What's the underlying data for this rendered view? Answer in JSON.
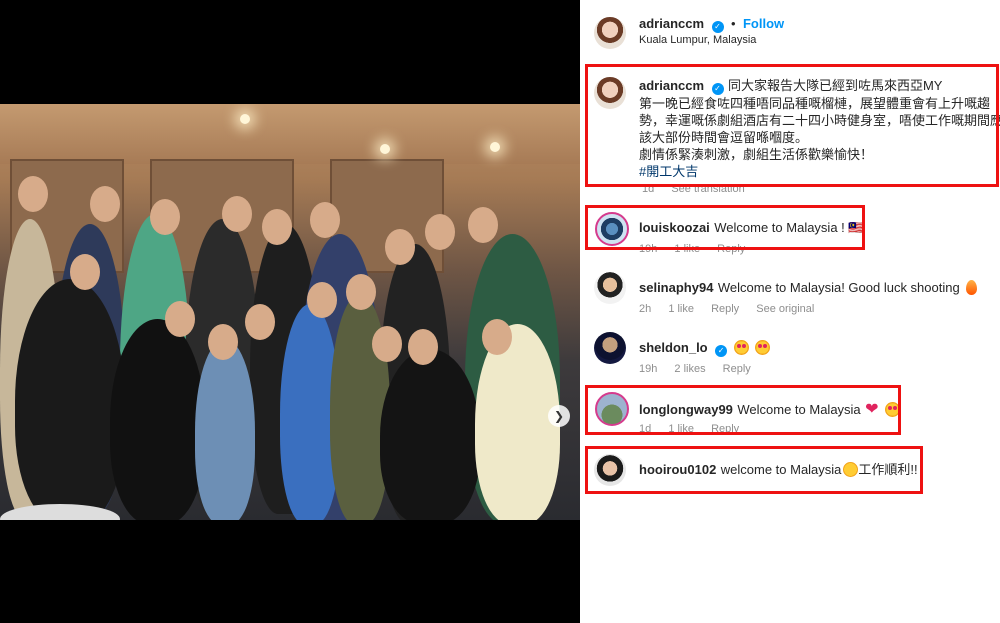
{
  "post": {
    "username": "adrianccm",
    "follow_label": "Follow",
    "separator": "•",
    "location": "Kuala Lumpur, Malaysia",
    "caption_line1": "同大家報告大隊已經到咗馬來西亞MY",
    "caption_line2": "第一晚已經食咗四種唔同品種嘅榴槤，展望體重會有上升嘅趨",
    "caption_line3": "勢，幸運嘅係劇組酒店有二十四小時健身室，唔使工作嘅期間應",
    "caption_line4": "該大部份時間會逗留喺嗰度。",
    "caption_line5": "劇情係緊湊刺激，劇組生活係歡樂愉快！",
    "hashtag": "#開工大吉",
    "time": "1d",
    "see_translation": "See translation"
  },
  "comments": [
    {
      "username": "louiskoozai",
      "text": "Welcome to Malaysia ! 🇲🇾",
      "time": "19h",
      "likes": "1 like",
      "reply": "Reply"
    },
    {
      "username": "selinaphy94",
      "text": "Welcome to Malaysia! Good luck shooting",
      "time": "2h",
      "likes": "1 like",
      "reply": "Reply",
      "extra": "See original"
    },
    {
      "username": "sheldon_lo",
      "text": "",
      "time": "19h",
      "likes": "2 likes",
      "reply": "Reply"
    },
    {
      "username": "longlongway99",
      "text": "Welcome to Malaysia",
      "time": "1d",
      "likes": "1 like",
      "reply": "Reply"
    },
    {
      "username": "hooirou0102",
      "text": "welcome to Malaysia",
      "text2": "工作順利!!"
    }
  ],
  "icons": {
    "verified": "verified-badge-icon",
    "next": "chevron-right-icon"
  },
  "colors": {
    "highlight": "#ee1111",
    "link": "#0095f6",
    "story_ring": "#d53b8d"
  }
}
